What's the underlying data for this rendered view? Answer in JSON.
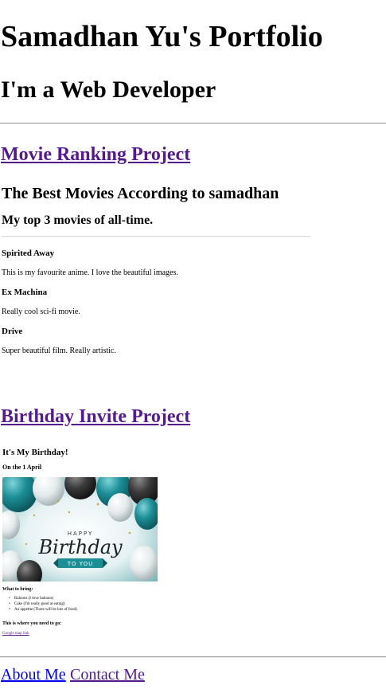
{
  "header": {
    "title": "Samadhan Yu's Portfolio",
    "subtitle": "I'm a Web Developer"
  },
  "projects": [
    {
      "link_label": "Movie Ranking Project",
      "embed": {
        "heading": "The Best Movies According to samadhan",
        "subheading": "My top 3 movies of all-time.",
        "movies": [
          {
            "title": "Spirited Away",
            "description": "This is my favourite anime. I love the beautiful images."
          },
          {
            "title": "Ex Machina",
            "description": "Really cool sci-fi movie."
          },
          {
            "title": "Drive",
            "description": "Super beautiful film. Really artistic."
          }
        ]
      }
    },
    {
      "link_label": "Birthday Invite Project",
      "embed": {
        "heading": "It's My Birthday!",
        "date_line": "On the 1 April",
        "image": {
          "top_text": "HAPPY",
          "main_text": "Birthday",
          "banner_text": "TO YOU"
        },
        "bring_heading": "What to bring:",
        "bring_items": [
          "Baloons (I love baloons)",
          "Cake (I'm really good at eating)",
          "An appetite (There will be lots of food)"
        ],
        "location_heading": "This is where you need to go:",
        "map_link": "Google map link"
      }
    }
  ],
  "footer": {
    "about_label": "About Me",
    "contact_label": "Contact Me"
  },
  "colors": {
    "visited_link": "#551a8b",
    "link": "#0000ee",
    "balloon_teal": "#1c8e96",
    "balloon_dark": "#3a3a3a"
  }
}
